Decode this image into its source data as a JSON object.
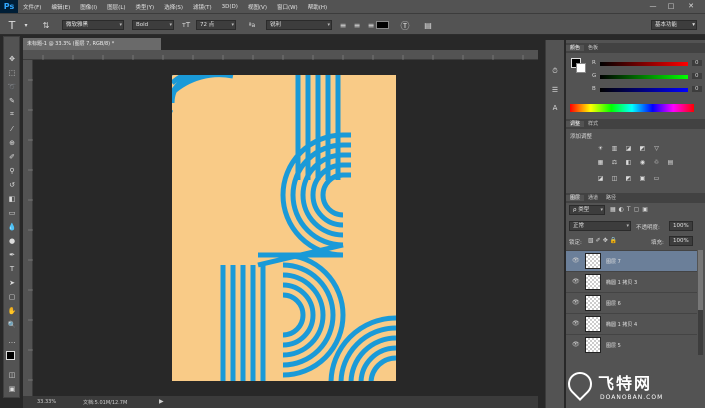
{
  "menubar": {
    "logo": "Ps",
    "items": [
      "文件(F)",
      "编辑(E)",
      "图像(I)",
      "图层(L)",
      "类型(Y)",
      "选择(S)",
      "滤镜(T)",
      "3D(D)",
      "视图(V)",
      "窗口(W)",
      "帮助(H)"
    ],
    "minimize": "—",
    "restore": "□",
    "close": "✕"
  },
  "options": {
    "font_family": "微软雅黑",
    "font_style": "Bold",
    "font_size": "72 点",
    "antialias": "锐利",
    "workspace": "基本功能"
  },
  "document": {
    "tab_title": "未标题-1 @ 33.3% (图层 7, RGB/8) *",
    "zoom": "33.33%",
    "doc_size": "文档:5.01M/12.7M",
    "canvas_bg": "#f9cb87",
    "stripe_color": "#1a9ad8"
  },
  "panels": {
    "color_tabs": [
      "颜色",
      "色板"
    ],
    "channels": [
      {
        "label": "R",
        "value": "0"
      },
      {
        "label": "G",
        "value": "0"
      },
      {
        "label": "B",
        "value": "0"
      }
    ],
    "adjust_tabs": [
      "调整",
      "样式"
    ],
    "adjust_title": "添加调整",
    "layer_tabs": [
      "图层",
      "通道",
      "路径"
    ],
    "kind": "ρ 类型",
    "blend_mode": "正常",
    "opacity_label": "不透明度:",
    "opacity_value": "100%",
    "lock_label": "锁定:",
    "fill_label": "填充:",
    "fill_value": "100%",
    "layers": [
      {
        "name": "图层 7",
        "selected": true
      },
      {
        "name": "椭圆 1 拷贝 3",
        "selected": false
      },
      {
        "name": "图层 6",
        "selected": false
      },
      {
        "name": "椭圆 1 拷贝 4",
        "selected": false
      },
      {
        "name": "图层 5",
        "selected": false
      }
    ]
  },
  "watermark": {
    "brand": "飞特网",
    "site": "DOANOBAN.COM"
  },
  "colors": {
    "chrome": "#535353",
    "dark": "#282828",
    "selected_layer": "#6b7f99"
  }
}
